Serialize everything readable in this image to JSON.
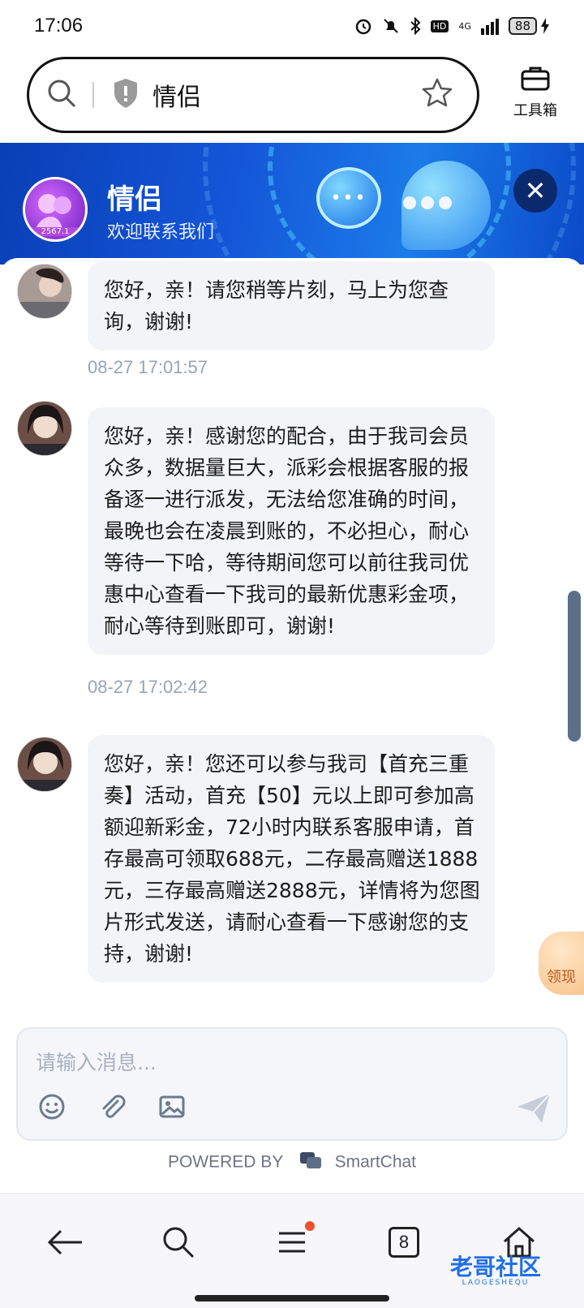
{
  "status_bar": {
    "time": "17:06",
    "network": "4G",
    "hd": "HD",
    "battery": "88"
  },
  "url_bar": {
    "text": "情侣",
    "toolbox_label": "工具箱"
  },
  "chat_header": {
    "title": "情侣",
    "subtitle": "欢迎联系我们",
    "avatar_tag": "2567.1"
  },
  "messages": [
    {
      "text": "您好，亲！请您稍等片刻，马上为您查询，谢谢!",
      "time": "08-27 17:01:57"
    },
    {
      "text": "您好，亲！感谢您的配合，由于我司会员众多，数据量巨大，派彩会根据客服的报备逐一进行派发，无法给您准确的时间，最晚也会在凌晨到账的，不必担心，耐心等待一下哈，等待期间您可以前往我司优惠中心查看一下我司的最新优惠彩金项，耐心等待到账即可，谢谢!",
      "time": "08-27 17:02:42"
    },
    {
      "text": "您好，亲！您还可以参与我司【首充三重奏】活动，首充【50】元以上即可参加高额迎新彩金，72小时内联系客服申请，首存最高可领取688元，二存最高赠送1888元，三存最高赠送2888元，详情将为您图片形式发送，请耐心查看一下感谢您的支持，谢谢!"
    }
  ],
  "promo_badge": "领现",
  "input": {
    "placeholder": "请输入消息..."
  },
  "powered_by": {
    "prefix": "POWERED BY",
    "brand": "SmartChat"
  },
  "bottom_nav": {
    "tab_count": "8"
  },
  "watermark": {
    "text": "老哥社区",
    "sub": "LAOGESHEQU"
  },
  "colors": {
    "header_blue": "#1456d8",
    "bubble_bg": "#f3f4f8",
    "time_gray": "#9aa3b5",
    "accent_red": "#ef4f2c"
  }
}
